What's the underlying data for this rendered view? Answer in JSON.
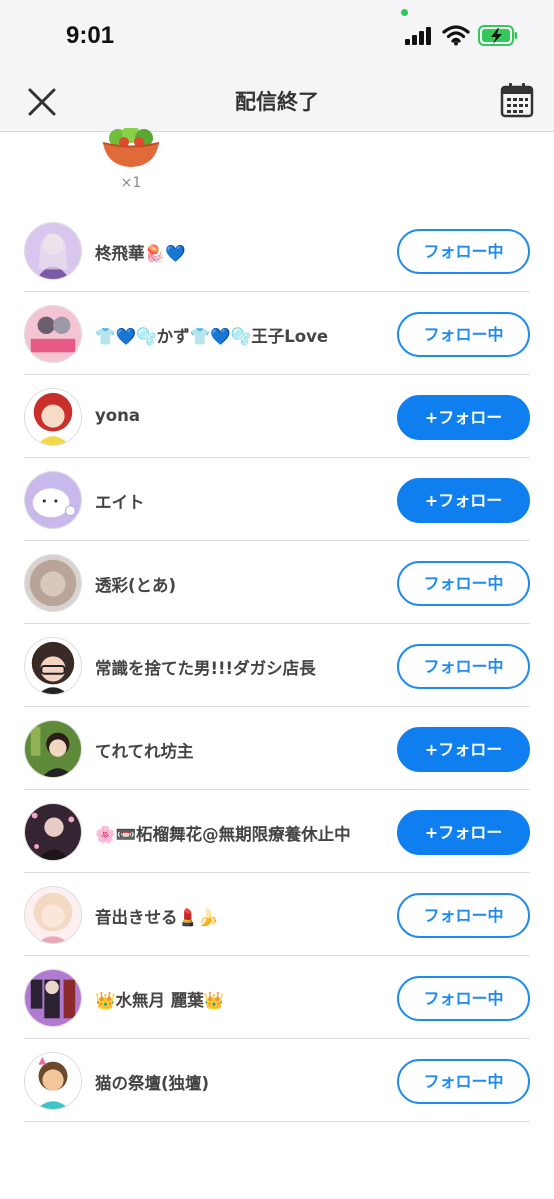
{
  "status_bar": {
    "time": "9:01"
  },
  "header": {
    "title": "配信終了"
  },
  "gift": {
    "count": "×1"
  },
  "users": [
    {
      "name": "柊飛華🪼💙",
      "button": "フォロー中",
      "following": true,
      "avatar_color": "#d9c6ef"
    },
    {
      "name": "👕💙🫧かず👕💙🫧王子Love",
      "button": "フォロー中",
      "following": true,
      "avatar_color": "#f4c4d2"
    },
    {
      "name": "yona",
      "button": "+フォロー",
      "following": false,
      "avatar_color": "#c9302c"
    },
    {
      "name": "エイト",
      "button": "+フォロー",
      "following": false,
      "avatar_color": "#c8b8ec"
    },
    {
      "name": "透彩(とあ)",
      "button": "フォロー中",
      "following": true,
      "avatar_color": "#b8a499"
    },
    {
      "name": "常識を捨てた男!!!ダガシ店長",
      "button": "フォロー中",
      "following": true,
      "avatar_color": "#3a2a25"
    },
    {
      "name": "てれてれ坊主",
      "button": "+フォロー",
      "following": false,
      "avatar_color": "#5e8a3a"
    },
    {
      "name": "🌸📼柘榴舞花@無期限療養休止中",
      "button": "+フォロー",
      "following": false,
      "avatar_color": "#352533"
    },
    {
      "name": "音出きせる💄🍌",
      "button": "フォロー中",
      "following": true,
      "avatar_color": "#f3d9c3"
    },
    {
      "name": "👑水無月 麗葉👑",
      "button": "フォロー中",
      "following": true,
      "avatar_color": "#b17ad1"
    },
    {
      "name": "猫の祭壇(独壇)",
      "button": "フォロー中",
      "following": true,
      "avatar_color": "#6b4a2c"
    }
  ]
}
